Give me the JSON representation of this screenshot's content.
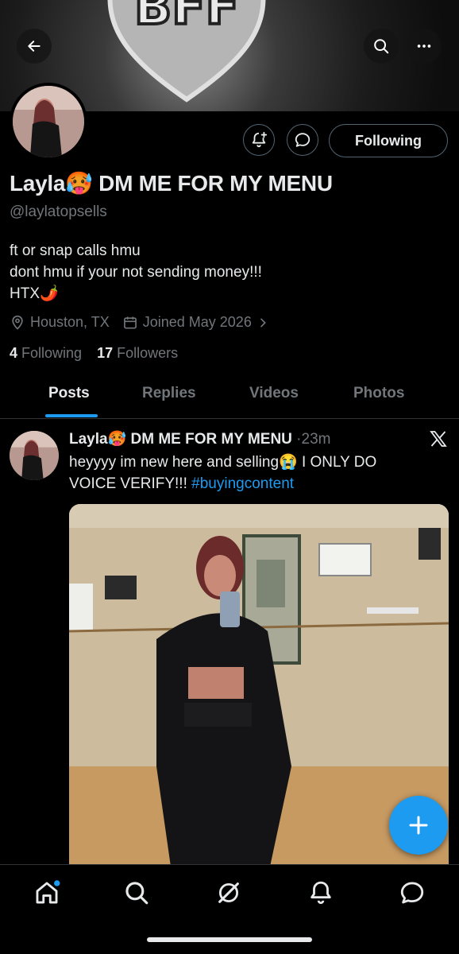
{
  "banner": {
    "text": "BFF"
  },
  "header": {
    "back_icon": "arrow-left-icon",
    "search_icon": "search-icon",
    "more_icon": "more-horizontal-icon"
  },
  "profile": {
    "display_name": "Layla🥵 DM ME FOR MY MENU",
    "handle": "@laylatopsells",
    "bio_lines": [
      "ft or snap calls hmu",
      "dont hmu if your not sending money!!!",
      "HTX🌶️"
    ],
    "location": "Houston, TX",
    "joined": "Joined May 2026",
    "following_count": "4",
    "following_label": "Following",
    "followers_count": "17",
    "followers_label": "Followers",
    "follow_button": "Following"
  },
  "tabs": [
    {
      "label": "Posts",
      "active": true
    },
    {
      "label": "Replies",
      "active": false
    },
    {
      "label": "Videos",
      "active": false
    },
    {
      "label": "Photos",
      "active": false
    }
  ],
  "post": {
    "author": "Layla🥵 DM ME FOR MY MENU",
    "separator": "·",
    "time": "23m",
    "text_part1": "heyyyy im new here and selling😭 I ONLY DO VOICE VERIFY!!! ",
    "hashtag": "#buyingcontent"
  },
  "colors": {
    "accent": "#1d9bf0",
    "muted": "#71767b",
    "border": "#536471",
    "background": "#000000"
  }
}
